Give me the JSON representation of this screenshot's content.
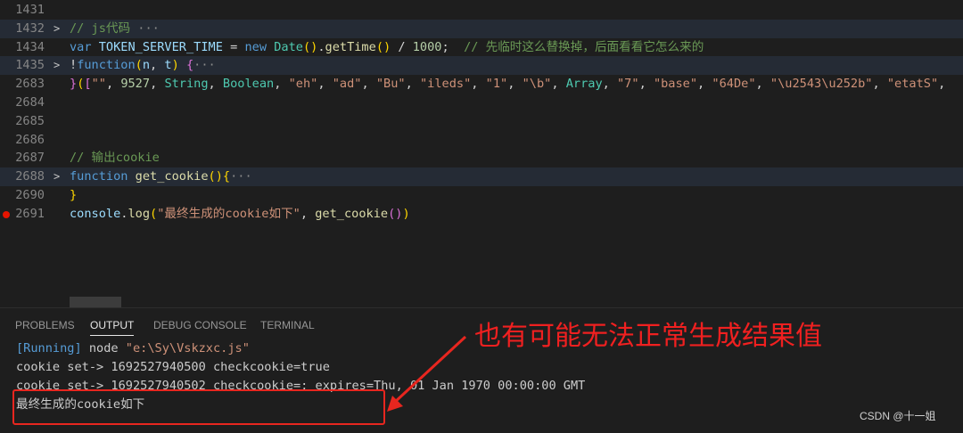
{
  "editor": {
    "lines": [
      {
        "num": "1431",
        "fold": "",
        "folded": false,
        "tokens": []
      },
      {
        "num": "1432",
        "fold": ">",
        "folded": true,
        "tokens": [
          {
            "t": "// js代码",
            "c": "cm"
          },
          {
            "t": " ···",
            "c": "ell"
          }
        ]
      },
      {
        "num": "1434",
        "fold": "",
        "folded": false,
        "tokens": [
          {
            "t": "var",
            "c": "kw"
          },
          {
            "t": " ",
            "c": ""
          },
          {
            "t": "TOKEN_SERVER_TIME",
            "c": "var"
          },
          {
            "t": " = ",
            "c": ""
          },
          {
            "t": "new",
            "c": "kw"
          },
          {
            "t": " ",
            "c": ""
          },
          {
            "t": "Date",
            "c": "cls"
          },
          {
            "t": "()",
            "c": "br1"
          },
          {
            "t": ".",
            "c": ""
          },
          {
            "t": "getTime",
            "c": "fn"
          },
          {
            "t": "()",
            "c": "br1"
          },
          {
            "t": " / ",
            "c": ""
          },
          {
            "t": "1000",
            "c": "num"
          },
          {
            "t": ";  ",
            "c": ""
          },
          {
            "t": "// 先临时这么替换掉，后面看看它怎么来的",
            "c": "cm"
          }
        ]
      },
      {
        "num": "1435",
        "fold": ">",
        "folded": true,
        "tokens": [
          {
            "t": "!",
            "c": ""
          },
          {
            "t": "function",
            "c": "kw"
          },
          {
            "t": "(",
            "c": "br1"
          },
          {
            "t": "n",
            "c": "var"
          },
          {
            "t": ", ",
            "c": ""
          },
          {
            "t": "t",
            "c": "var"
          },
          {
            "t": ")",
            "c": "br1"
          },
          {
            "t": " ",
            "c": ""
          },
          {
            "t": "{",
            "c": "br2"
          },
          {
            "t": "···",
            "c": "ell"
          }
        ]
      },
      {
        "num": "2683",
        "fold": "",
        "folded": false,
        "tokens": [
          {
            "t": "}",
            "c": "br2"
          },
          {
            "t": "(",
            "c": "br1"
          },
          {
            "t": "[",
            "c": "br2"
          },
          {
            "t": "\"\"",
            "c": "str"
          },
          {
            "t": ", ",
            "c": ""
          },
          {
            "t": "9527",
            "c": "num"
          },
          {
            "t": ", ",
            "c": ""
          },
          {
            "t": "String",
            "c": "cls"
          },
          {
            "t": ", ",
            "c": ""
          },
          {
            "t": "Boolean",
            "c": "cls"
          },
          {
            "t": ", ",
            "c": ""
          },
          {
            "t": "\"eh\"",
            "c": "str"
          },
          {
            "t": ", ",
            "c": ""
          },
          {
            "t": "\"ad\"",
            "c": "str"
          },
          {
            "t": ", ",
            "c": ""
          },
          {
            "t": "\"Bu\"",
            "c": "str"
          },
          {
            "t": ", ",
            "c": ""
          },
          {
            "t": "\"ileds\"",
            "c": "str"
          },
          {
            "t": ", ",
            "c": ""
          },
          {
            "t": "\"1\"",
            "c": "str"
          },
          {
            "t": ", ",
            "c": ""
          },
          {
            "t": "\"\\b\"",
            "c": "str"
          },
          {
            "t": ", ",
            "c": ""
          },
          {
            "t": "Array",
            "c": "cls"
          },
          {
            "t": ", ",
            "c": ""
          },
          {
            "t": "\"7\"",
            "c": "str"
          },
          {
            "t": ", ",
            "c": ""
          },
          {
            "t": "\"base\"",
            "c": "str"
          },
          {
            "t": ", ",
            "c": ""
          },
          {
            "t": "\"64De\"",
            "c": "str"
          },
          {
            "t": ", ",
            "c": ""
          },
          {
            "t": "\"\\u2543\\u252b\"",
            "c": "str"
          },
          {
            "t": ", ",
            "c": ""
          },
          {
            "t": "\"etatS\"",
            "c": "str"
          },
          {
            "t": ",",
            "c": ""
          }
        ]
      },
      {
        "num": "2684",
        "fold": "",
        "folded": false,
        "tokens": []
      },
      {
        "num": "2685",
        "fold": "",
        "folded": false,
        "tokens": []
      },
      {
        "num": "2686",
        "fold": "",
        "folded": false,
        "tokens": []
      },
      {
        "num": "2687",
        "fold": "",
        "folded": false,
        "tokens": [
          {
            "t": "// 输出cookie",
            "c": "cm"
          }
        ]
      },
      {
        "num": "2688",
        "fold": ">",
        "folded": true,
        "tokens": [
          {
            "t": "function",
            "c": "kw"
          },
          {
            "t": " ",
            "c": ""
          },
          {
            "t": "get_cookie",
            "c": "fn"
          },
          {
            "t": "()",
            "c": "br1"
          },
          {
            "t": "{",
            "c": "br1"
          },
          {
            "t": "···",
            "c": "ell"
          }
        ]
      },
      {
        "num": "2690",
        "fold": "",
        "folded": false,
        "tokens": [
          {
            "t": "}",
            "c": "br1"
          }
        ]
      },
      {
        "num": "2691",
        "fold": "",
        "folded": false,
        "breakpoint": true,
        "tokens": [
          {
            "t": "console",
            "c": "var"
          },
          {
            "t": ".",
            "c": ""
          },
          {
            "t": "log",
            "c": "fn"
          },
          {
            "t": "(",
            "c": "br1"
          },
          {
            "t": "\"最终生成的cookie如下\"",
            "c": "str"
          },
          {
            "t": ", ",
            "c": ""
          },
          {
            "t": "get_cookie",
            "c": "fn"
          },
          {
            "t": "()",
            "c": "br2"
          },
          {
            "t": ")",
            "c": "br1"
          }
        ]
      }
    ]
  },
  "panel": {
    "tabs": [
      "PROBLEMS",
      "OUTPUT",
      "DEBUG CONSOLE",
      "TERMINAL"
    ],
    "active_tab": "OUTPUT",
    "output": {
      "running_tag": "[Running]",
      "running_cmd": " node ",
      "running_path": "\"e:\\Sy\\Vskzxc.js\"",
      "line2": "cookie set-> 1692527940500 checkcookie=true",
      "line3": "cookie set-> 1692527940502 checkcookie=; expires=Thu, 01 Jan 1970 00:00:00 GMT",
      "line4": "最终生成的cookie如下"
    }
  },
  "annotation": {
    "text": "也有可能无法正常生成结果值",
    "color": "#f02020"
  },
  "watermark": "CSDN @十一姐"
}
